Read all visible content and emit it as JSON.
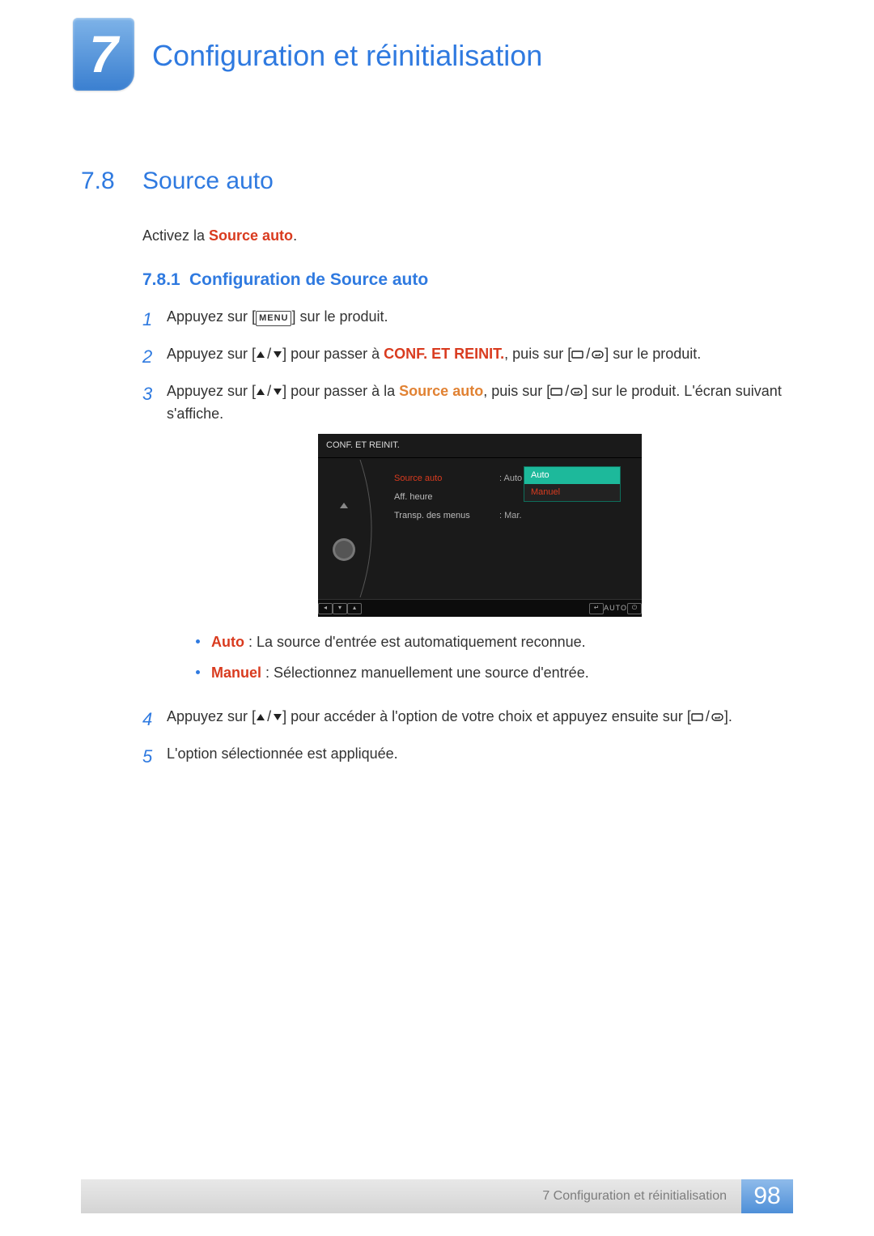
{
  "header": {
    "chapter_number": "7",
    "chapter_title": "Configuration et réinitialisation"
  },
  "section": {
    "number": "7.8",
    "title": "Source auto",
    "intro_pre": "Activez la ",
    "intro_em": "Source auto",
    "intro_post": "."
  },
  "subsection": {
    "number": "7.8.1",
    "title": "Configuration de Source auto"
  },
  "steps": {
    "s1": {
      "num": "1",
      "t1": "Appuyez sur [",
      "menu": "MENU",
      "t2": "] sur le produit."
    },
    "s2": {
      "num": "2",
      "t1": "Appuyez sur [",
      "t2": "] pour passer à ",
      "em": "CONF. ET REINIT.",
      "t3": ", puis sur [",
      "t4": "] sur le produit."
    },
    "s3": {
      "num": "3",
      "t1": "Appuyez sur [",
      "t2": "] pour passer à la ",
      "em": "Source auto",
      "t3": ", puis sur [",
      "t4": "] sur le produit. L'écran suivant s'affiche."
    },
    "s4": {
      "num": "4",
      "t1": "Appuyez sur [",
      "t2": "] pour accéder à l'option de votre choix et appuyez ensuite sur [",
      "t3": "]."
    },
    "s5": {
      "num": "5",
      "t1": "L'option sélectionnée est appliquée."
    }
  },
  "osd": {
    "title": "CONF. ET REINIT.",
    "rows": [
      {
        "label": "Source auto",
        "value": "Auto"
      },
      {
        "label": "Aff. heure",
        "value": ""
      },
      {
        "label": "Transp. des menus",
        "value": ": Mar."
      }
    ],
    "popup": [
      "Auto",
      "Manuel"
    ],
    "bottom_auto": "AUTO"
  },
  "bullets": {
    "b1": {
      "em": "Auto",
      "text": " : La source d'entrée est automatiquement reconnue."
    },
    "b2": {
      "em": "Manuel",
      "text": " : Sélectionnez manuellement une source d'entrée."
    }
  },
  "footer": {
    "text": "7 Configuration et réinitialisation",
    "page": "98"
  }
}
